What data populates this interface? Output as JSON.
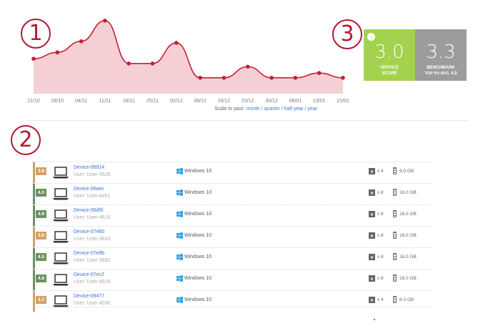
{
  "callouts": [
    "1",
    "2",
    "3"
  ],
  "chart_data": {
    "type": "area",
    "categories": [
      "21/10",
      "28/10",
      "04/11",
      "11/11",
      "18/11",
      "25/11",
      "02/12",
      "09/12",
      "16/12",
      "23/12",
      "30/12",
      "06/01",
      "13/01",
      "21/01"
    ],
    "values": [
      3.2,
      3.6,
      4.3,
      5.6,
      2.9,
      2.9,
      4.2,
      2.0,
      2.0,
      2.7,
      2.0,
      2.0,
      2.3,
      2.0
    ],
    "ylim": [
      1,
      6
    ],
    "grid": false,
    "colors": {
      "line": "#c31f3a",
      "fill": "#f5cfd3"
    }
  },
  "scale": {
    "prefix": "Scale to past:",
    "links": [
      "month",
      "quarter",
      "half year",
      "year"
    ],
    "sep": "/"
  },
  "service_score": {
    "value": "3.0",
    "label_line1": "SERVICE",
    "label_line2": "SCORE",
    "color": "#a3d24f"
  },
  "benchmark": {
    "value": "3.3",
    "label": "BENCHMARK",
    "sub_prefix": "TOP 5% AVG.",
    "sub_value": "4.0",
    "color": "#9c9c9c"
  },
  "devices": [
    {
      "score": "3.8",
      "color": "#d2a06a",
      "name": "Device-06914",
      "user": "User: User-3528",
      "os": "Windows 10",
      "cores": "x 4",
      "ram": "8.0 GB"
    },
    {
      "score": "4.0",
      "color": "#6b9160",
      "name": "Device-06aec",
      "user": "User: User-4451",
      "os": "Windows 10",
      "cores": "x 8",
      "ram": "16.0 GB"
    },
    {
      "score": "4.9",
      "color": "#6b9160",
      "name": "Device-06d5f",
      "user": "User: User-4618",
      "os": "Windows 10",
      "cores": "x 8",
      "ram": "16.0 GB"
    },
    {
      "score": "3.8",
      "color": "#d2a06a",
      "name": "Device-07460",
      "user": "User: User-3833",
      "os": "Windows 10",
      "cores": "x 8",
      "ram": "16.0 GB"
    },
    {
      "score": "4.5",
      "color": "#6b9160",
      "name": "Device-07e9b",
      "user": "User: User-3992",
      "os": "Windows 10",
      "cores": "x 8",
      "ram": "16.0 GB"
    },
    {
      "score": "4.8",
      "color": "#6b9160",
      "name": "Device-07ec2",
      "user": "User: User-4625",
      "os": "Windows 10",
      "cores": "x 8",
      "ram": "16.0 GB"
    },
    {
      "score": "3.2",
      "color": "#d2a06a",
      "name": "Device-09477",
      "user": "User: User-4036",
      "os": "Windows 10",
      "cores": "x 4",
      "ram": "8.0 GB"
    }
  ],
  "icons": {
    "device": "laptop-icon",
    "os": "windows-logo-icon",
    "cpu": "cpu-icon",
    "ram": "memory-icon",
    "trend": "arrow-down-icon"
  }
}
